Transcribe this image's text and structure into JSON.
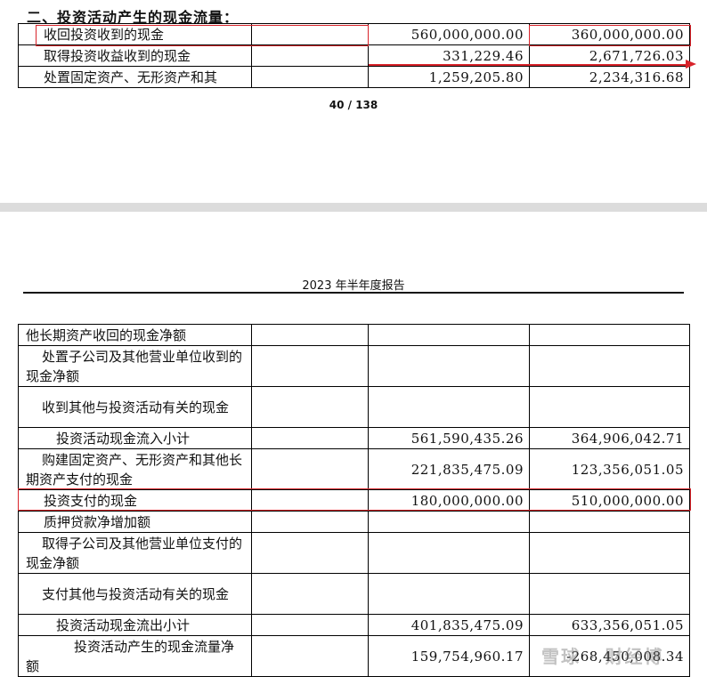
{
  "section_title": "二、投资活动产生的现金流量：",
  "top_rows": [
    {
      "label": "收回投资收到的现金",
      "current": "560,000,000.00",
      "prior": "360,000,000.00"
    },
    {
      "label": "取得投资收益收到的现金",
      "current": "331,229.46",
      "prior": "2,671,726.03"
    },
    {
      "label": "处置固定资产、无形资产和其",
      "current": "1,259,205.80",
      "prior": "2,234,316.68"
    }
  ],
  "page_number": "40 / 138",
  "report_header": "2023 年半年度报告",
  "bottom_rows": [
    {
      "label": "他长期资产收回的现金净额",
      "current": "",
      "prior": ""
    },
    {
      "label": "处置子公司及其他营业单位收到的现金净额",
      "current": "",
      "prior": ""
    },
    {
      "label": "收到其他与投资活动有关的现金",
      "current": "",
      "prior": ""
    },
    {
      "label": "投资活动现金流入小计",
      "current": "561,590,435.26",
      "prior": "364,906,042.71"
    },
    {
      "label": "购建固定资产、无形资产和其他长期资产支付的现金",
      "current": "221,835,475.09",
      "prior": "123,356,051.05"
    },
    {
      "label": "投资支付的现金",
      "current": "180,000,000.00",
      "prior": "510,000,000.00"
    },
    {
      "label": "质押贷款净增加额",
      "current": "",
      "prior": ""
    },
    {
      "label": "取得子公司及其他营业单位支付的现金净额",
      "current": "",
      "prior": ""
    },
    {
      "label": "支付其他与投资活动有关的现金",
      "current": "",
      "prior": ""
    },
    {
      "label": "投资活动现金流出小计",
      "current": "401,835,475.09",
      "prior": "633,356,051.05"
    },
    {
      "label": "投资活动产生的现金流量净额",
      "current": "159,754,960.17",
      "prior": "-268,450,008.34"
    }
  ],
  "watermark": "雪球 · 财经博",
  "colors": {
    "highlight": "#d8232a",
    "page_gap": "#dcdcdc"
  }
}
